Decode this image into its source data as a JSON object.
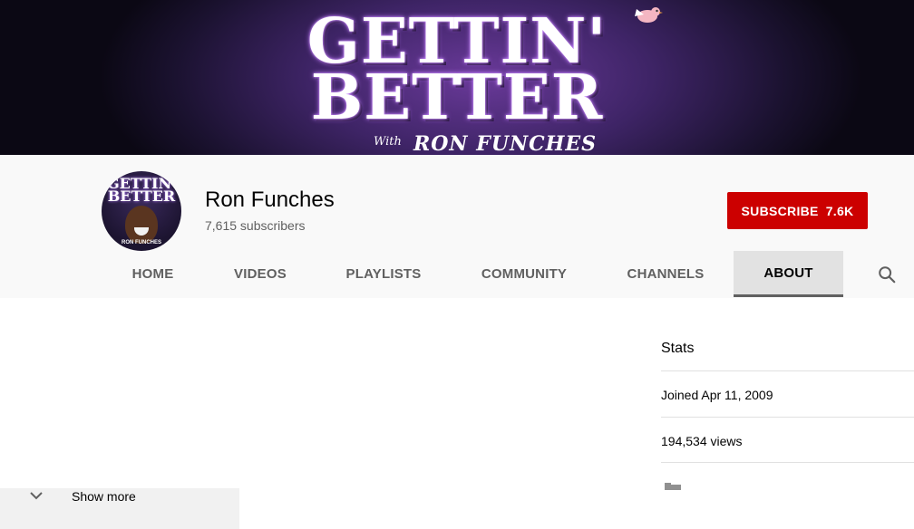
{
  "banner": {
    "title_line1": "GETTIN'",
    "title_line2": "BETTER",
    "with": "With",
    "host": "RON FUNCHES"
  },
  "channel": {
    "name": "Ron Funches",
    "subscribers": "7,615 subscribers",
    "avatar_text_line1": "GETTIN'",
    "avatar_text_line2": "BETTER",
    "avatar_footer": "RON FUNCHES"
  },
  "subscribe": {
    "label": "SUBSCRIBE",
    "count": "7.6K",
    "color": "#cc0000"
  },
  "tabs": [
    {
      "label": "HOME"
    },
    {
      "label": "VIDEOS"
    },
    {
      "label": "PLAYLISTS"
    },
    {
      "label": "COMMUNITY"
    },
    {
      "label": "CHANNELS"
    },
    {
      "label": "ABOUT",
      "active": true
    }
  ],
  "search": {
    "icon": "search-icon"
  },
  "stats": {
    "title": "Stats",
    "joined": "Joined Apr 11, 2009",
    "views": "194,534 views"
  },
  "show_more": {
    "label": "Show more",
    "icon": "chevron-down-icon"
  }
}
